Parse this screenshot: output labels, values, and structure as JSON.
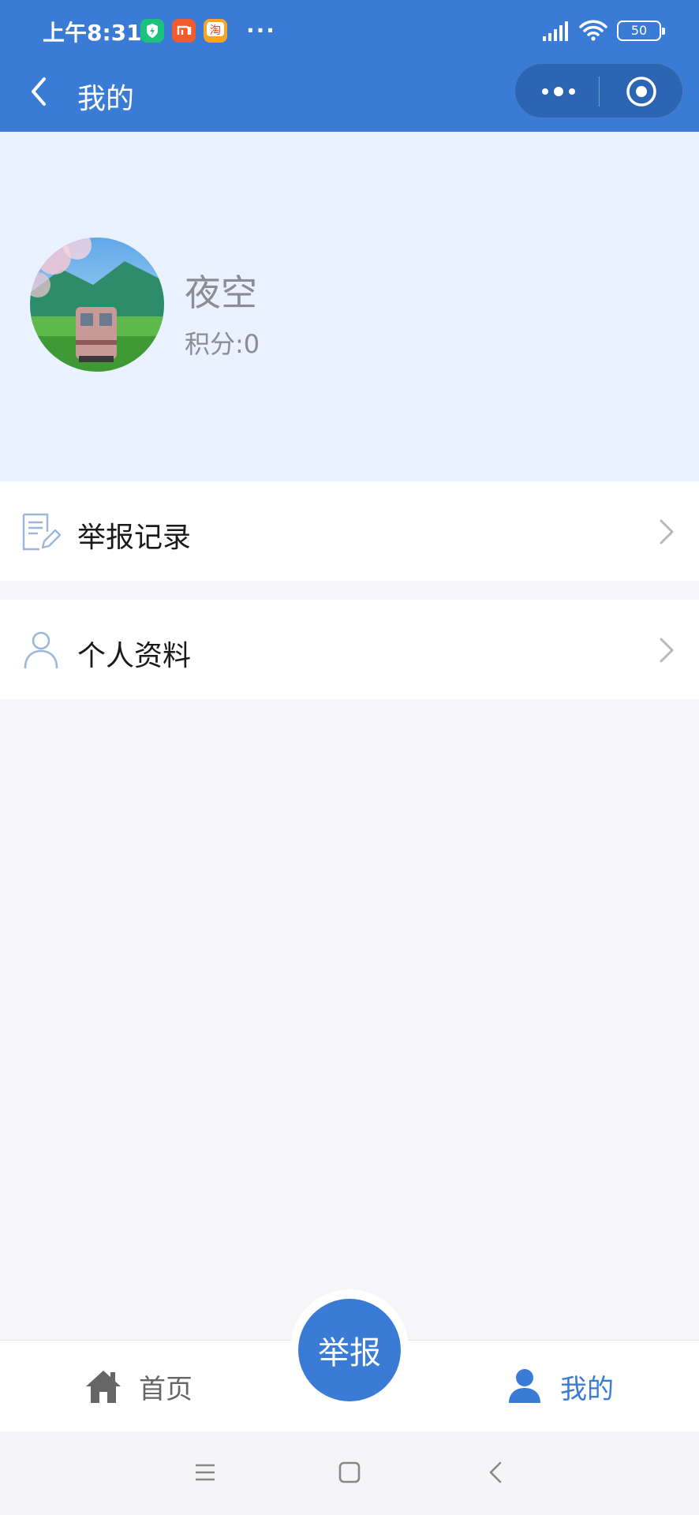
{
  "status_bar": {
    "time": "上午8:31",
    "more": "···",
    "battery": "50",
    "app_icons": [
      "security-app-icon",
      "mi-app-icon",
      "taobao-app-icon"
    ],
    "colors": {
      "security": "#19c37d",
      "mi": "#f25b2d",
      "taobao": "#f6a623"
    }
  },
  "nav": {
    "title": "我的"
  },
  "profile": {
    "name": "夜空",
    "points": "积分:0"
  },
  "menu": {
    "records": "举报记录",
    "profile_info": "个人资料"
  },
  "tabbar": {
    "home": "首页",
    "report": "举报",
    "mine": "我的"
  },
  "colors": {
    "accent": "#3a7bd5",
    "profile_bg": "#e9f2fe",
    "page_bg": "#f6f6f8"
  }
}
